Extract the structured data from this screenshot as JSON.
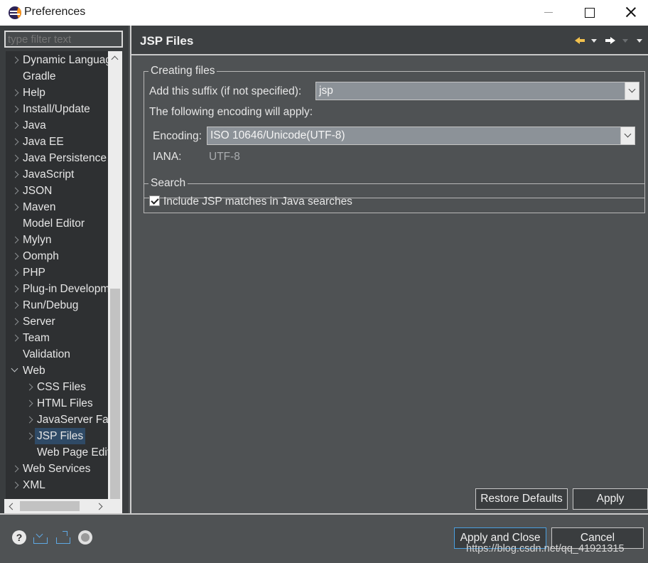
{
  "window": {
    "title": "Preferences"
  },
  "filter": {
    "placeholder": "type filter text"
  },
  "tree": {
    "items": [
      {
        "label": "Dynamic Languages",
        "level": 0,
        "arrow": "right"
      },
      {
        "label": "Gradle",
        "level": 0,
        "arrow": "none"
      },
      {
        "label": "Help",
        "level": 0,
        "arrow": "right"
      },
      {
        "label": "Install/Update",
        "level": 0,
        "arrow": "right"
      },
      {
        "label": "Java",
        "level": 0,
        "arrow": "right"
      },
      {
        "label": "Java EE",
        "level": 0,
        "arrow": "right"
      },
      {
        "label": "Java Persistence",
        "level": 0,
        "arrow": "right"
      },
      {
        "label": "JavaScript",
        "level": 0,
        "arrow": "right"
      },
      {
        "label": "JSON",
        "level": 0,
        "arrow": "right"
      },
      {
        "label": "Maven",
        "level": 0,
        "arrow": "right"
      },
      {
        "label": "Model Editor",
        "level": 0,
        "arrow": "none"
      },
      {
        "label": "Mylyn",
        "level": 0,
        "arrow": "right"
      },
      {
        "label": "Oomph",
        "level": 0,
        "arrow": "right"
      },
      {
        "label": "PHP",
        "level": 0,
        "arrow": "right"
      },
      {
        "label": "Plug-in Development",
        "level": 0,
        "arrow": "right"
      },
      {
        "label": "Run/Debug",
        "level": 0,
        "arrow": "right"
      },
      {
        "label": "Server",
        "level": 0,
        "arrow": "right"
      },
      {
        "label": "Team",
        "level": 0,
        "arrow": "right"
      },
      {
        "label": "Validation",
        "level": 0,
        "arrow": "none"
      },
      {
        "label": "Web",
        "level": 0,
        "arrow": "down"
      },
      {
        "label": "CSS Files",
        "level": 1,
        "arrow": "right"
      },
      {
        "label": "HTML Files",
        "level": 1,
        "arrow": "right"
      },
      {
        "label": "JavaServer Faces",
        "level": 1,
        "arrow": "right"
      },
      {
        "label": "JSP Files",
        "level": 1,
        "arrow": "right",
        "selected": true
      },
      {
        "label": "Web Page Editor",
        "level": 1,
        "arrow": "none"
      },
      {
        "label": "Web Services",
        "level": 0,
        "arrow": "right"
      },
      {
        "label": "XML",
        "level": 0,
        "arrow": "right"
      }
    ]
  },
  "page": {
    "title": "JSP Files",
    "creating_files": {
      "label": "Creating files",
      "suffix_label": "Add this suffix (if not specified):",
      "suffix_value": "jsp",
      "encoding_hint": "The following encoding will apply:",
      "encoding_label": "Encoding:",
      "encoding_value": "ISO 10646/Unicode(UTF-8)",
      "iana_label": "IANA:",
      "iana_value": "UTF-8"
    },
    "search": {
      "label": "Search",
      "include_label": "Include JSP matches in Java searches",
      "include_checked": true
    },
    "restore_defaults": "Restore Defaults",
    "apply": "Apply"
  },
  "footer": {
    "apply_and_close": "Apply and Close",
    "cancel": "Cancel",
    "watermark": "https://blog.csdn.net/qq_41921315"
  },
  "icons": [
    "eclipse-icon",
    "minimize-icon",
    "maximize-icon",
    "close-icon",
    "back-icon",
    "forward-icon",
    "help-icon",
    "import-icon",
    "export-icon",
    "record-icon"
  ],
  "colors": {
    "background": "#4f5254",
    "tree_background": "#2e3032",
    "selection": "#2f4a66",
    "accent": "#4aa0e0"
  }
}
